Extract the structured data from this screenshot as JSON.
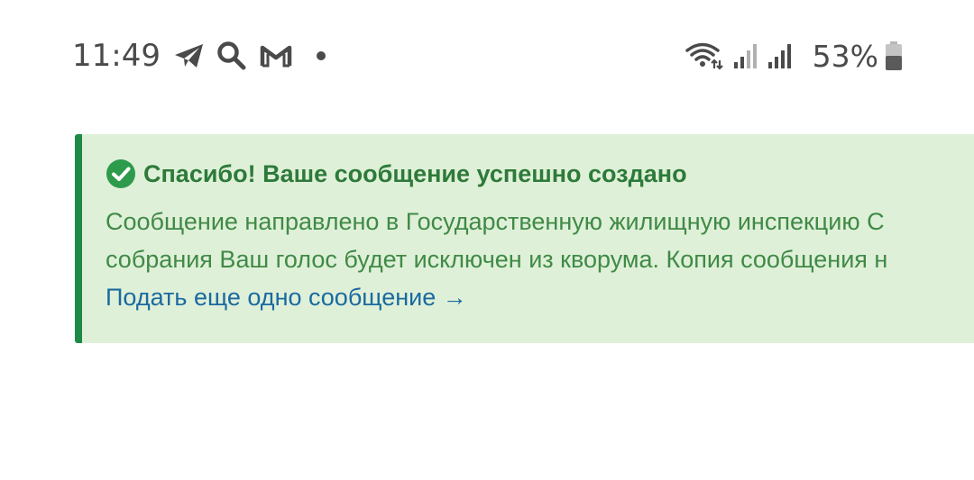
{
  "status_bar": {
    "time": "11:49",
    "notification_icons": [
      "telegram-icon",
      "search-icon",
      "gmail-icon",
      "more-notifications-dot"
    ],
    "system_icons": [
      "wifi-icon",
      "cellular-signal-icon",
      "cellular-signal-icon"
    ],
    "battery_percent": "53%"
  },
  "alert": {
    "title": "Спасибо! Ваше сообщение успешно создано",
    "lines": [
      "Сообщение направлено в Государственную жилищную инспекцию С",
      "собрания Ваш голос будет исключен из кворума. Копия сообщения н"
    ],
    "link_label": "Подать еще одно сообщение →",
    "colors": {
      "background": "#dff0d8",
      "border": "#1e8a45",
      "title": "#2d7a3a",
      "text": "#3f8a46",
      "link": "#1a6aa0"
    }
  }
}
